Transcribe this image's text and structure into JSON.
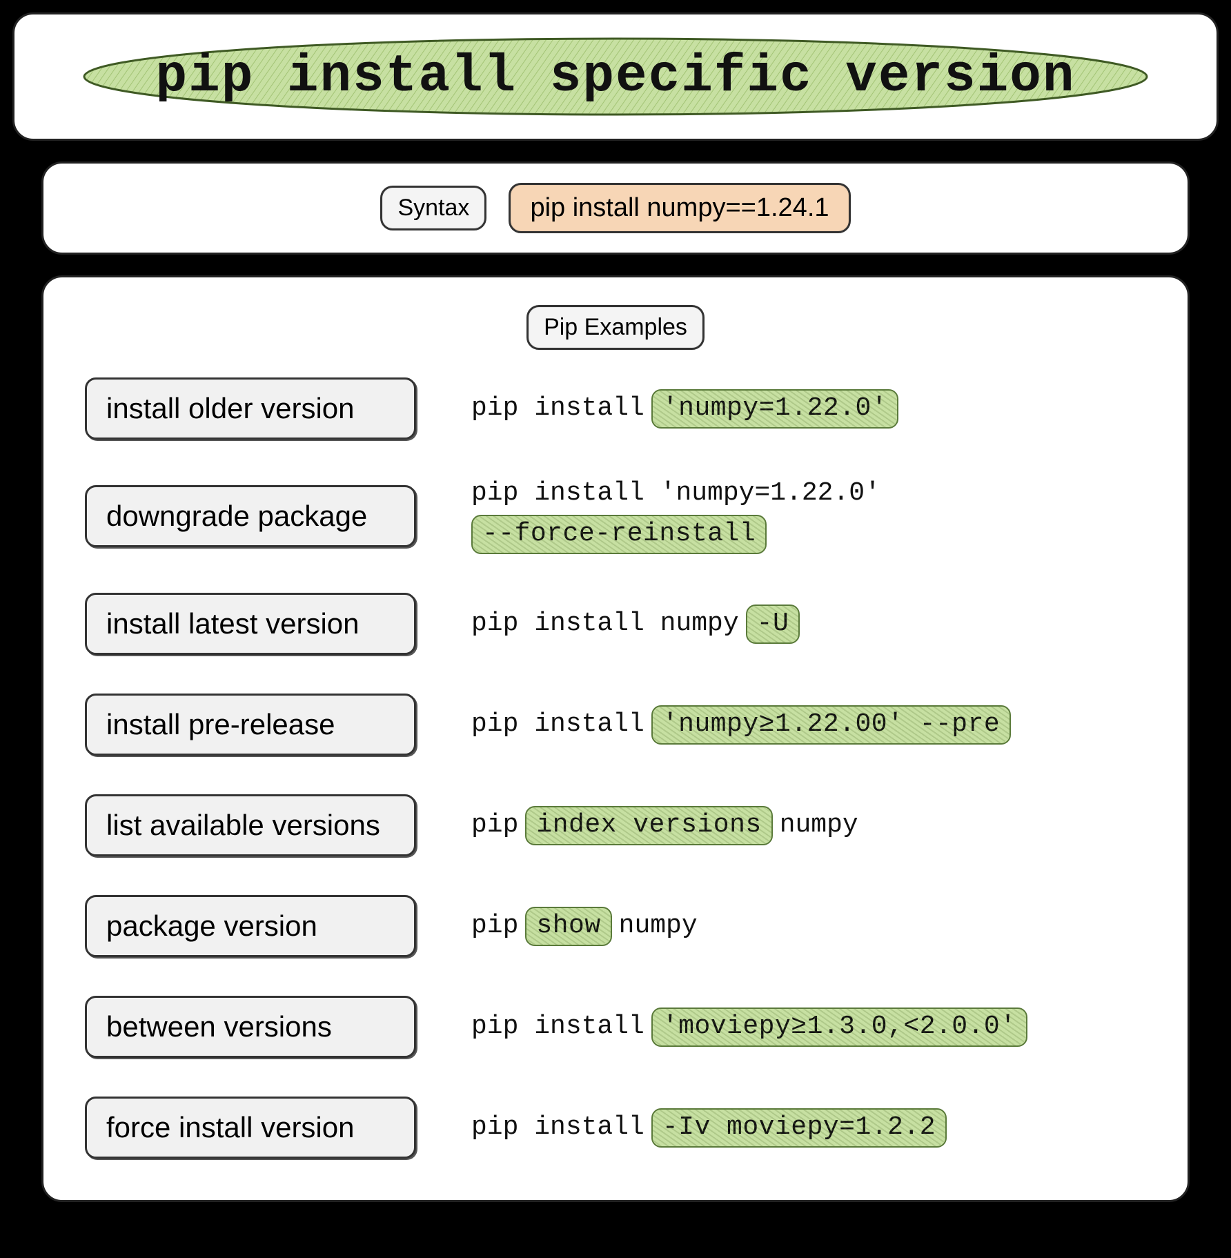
{
  "title": "pip install specific version",
  "syntax": {
    "label": "Syntax",
    "command": "pip install numpy==1.24.1"
  },
  "section_title": "Pip Examples",
  "examples": [
    {
      "label": "install older version",
      "pre": "pip install ",
      "hl": "'numpy=1.22.0'",
      "post": ""
    },
    {
      "label": "downgrade package",
      "pre": "pip install 'numpy=1.22.0' ",
      "hl": "--force-reinstall",
      "post": ""
    },
    {
      "label": "install latest version",
      "pre": "pip install numpy ",
      "hl": "-U",
      "post": ""
    },
    {
      "label": "install pre-release",
      "pre": "pip install ",
      "hl": "'numpy≥1.22.00' --pre",
      "post": ""
    },
    {
      "label": "list available versions",
      "pre": "pip ",
      "hl": "index versions",
      "post": " numpy"
    },
    {
      "label": "package version",
      "pre": "pip ",
      "hl": "show",
      "post": " numpy"
    },
    {
      "label": "between versions",
      "pre": "pip install ",
      "hl": "'moviepy≥1.3.0,<2.0.0'",
      "post": ""
    },
    {
      "label": "force install version",
      "pre": "pip install ",
      "hl": "-Iv moviepy=1.2.2",
      "post": ""
    }
  ]
}
